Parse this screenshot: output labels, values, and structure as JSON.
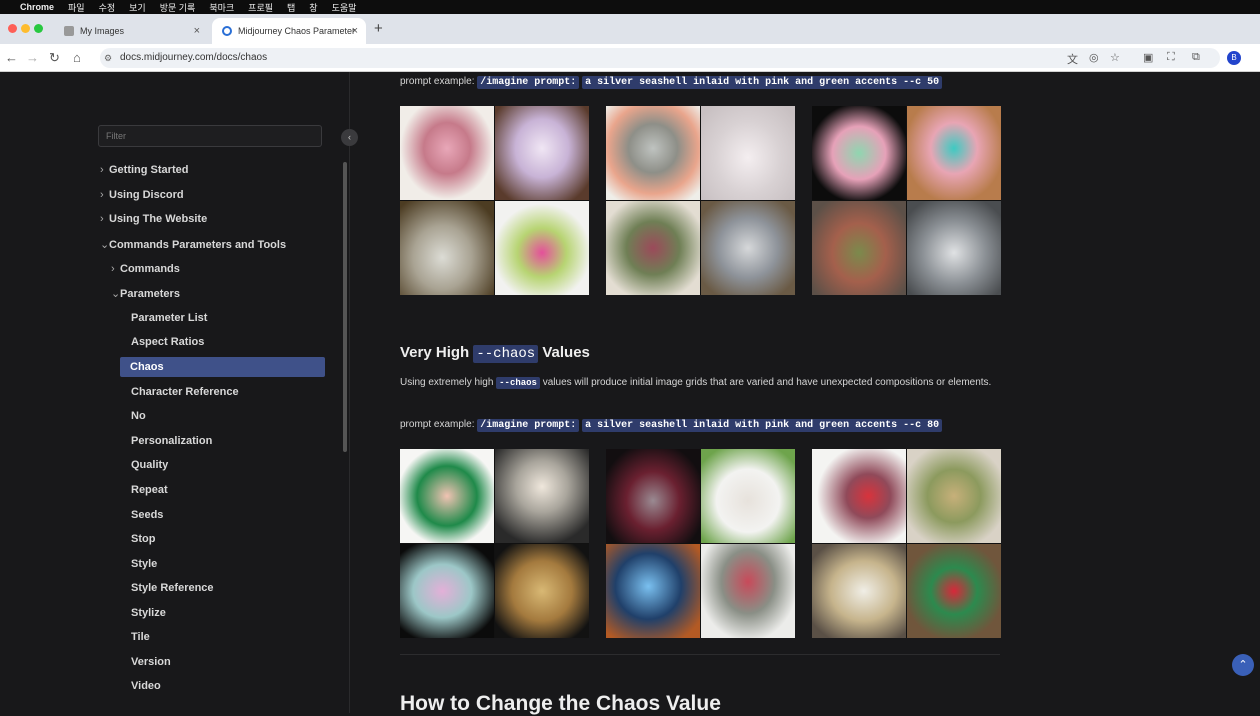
{
  "menubar": {
    "apple": "",
    "app_name": "Chrome",
    "items": [
      "파일",
      "수정",
      "보기",
      "방문 기록",
      "북마크",
      "프로필",
      "탭",
      "창",
      "도움말"
    ]
  },
  "tabs": [
    {
      "title": "My Images",
      "close": "×"
    },
    {
      "title": "Midjourney Chaos Parameter",
      "close": "×"
    }
  ],
  "newtab_label": "+",
  "address": {
    "url": "docs.midjourney.com/docs/chaos",
    "profile_initial": "B"
  },
  "sidebar": {
    "filter_placeholder": "Filter",
    "collapse_glyph": "‹",
    "items": [
      {
        "label": "Getting Started",
        "chevron": "›"
      },
      {
        "label": "Using Discord",
        "chevron": "›"
      },
      {
        "label": "Using The Website",
        "chevron": "›"
      },
      {
        "label": "Commands Parameters and Tools",
        "chevron": "⌄"
      },
      {
        "label": "Commands",
        "chevron": "›"
      },
      {
        "label": "Parameters",
        "chevron": "⌄"
      },
      {
        "label": "Parameter List"
      },
      {
        "label": "Aspect Ratios"
      },
      {
        "label": "Chaos"
      },
      {
        "label": "Character Reference"
      },
      {
        "label": "No"
      },
      {
        "label": "Personalization"
      },
      {
        "label": "Quality"
      },
      {
        "label": "Repeat"
      },
      {
        "label": "Seeds"
      },
      {
        "label": "Stop"
      },
      {
        "label": "Style"
      },
      {
        "label": "Style Reference"
      },
      {
        "label": "Stylize"
      },
      {
        "label": "Tile"
      },
      {
        "label": "Version"
      },
      {
        "label": "Video"
      }
    ]
  },
  "content": {
    "prompt1": {
      "label": "prompt example:",
      "cmd": "/imagine prompt:",
      "text": "a silver seashell inlaid with pink and green accents --c 50"
    },
    "section_title_pre": "Very High",
    "section_title_code": "--chaos",
    "section_title_post": "Values",
    "para_pre": "Using extremely high",
    "para_code": "--chaos",
    "para_post": "values will produce initial image grids that are varied and have unexpected compositions or elements.",
    "prompt2": {
      "label": "prompt example:",
      "cmd": "/imagine prompt:",
      "text": "a silver seashell inlaid with pink and green accents --c 80"
    },
    "next_heading": "How to Change the Chaos Value",
    "scroll_top_glyph": "⌃"
  },
  "colors": {
    "accent": "#3f5189",
    "code_bg": "#2f3c6b",
    "background": "#18181a"
  }
}
